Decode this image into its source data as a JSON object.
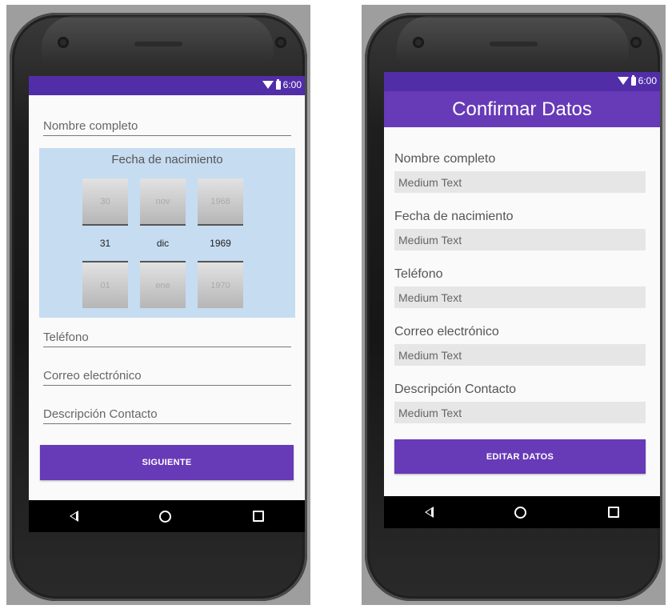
{
  "status": {
    "time": "6:00"
  },
  "form": {
    "name_placeholder": "Nombre completo",
    "date_title": "Fecha de nacimiento",
    "picker": {
      "day": {
        "prev": "30",
        "current": "31",
        "next": "01"
      },
      "month": {
        "prev": "nov",
        "current": "dic",
        "next": "ene"
      },
      "year": {
        "prev": "1968",
        "current": "1969",
        "next": "1970"
      }
    },
    "phone_placeholder": "Teléfono",
    "email_placeholder": "Correo electrónico",
    "description_placeholder": "Descripción Contacto",
    "next_button": "SIGUIENTE"
  },
  "confirm": {
    "title": "Confirmar Datos",
    "fields": [
      {
        "label": "Nombre completo",
        "value": "Medium Text"
      },
      {
        "label": "Fecha de nacimiento",
        "value": "Medium Text"
      },
      {
        "label": "Teléfono",
        "value": "Medium Text"
      },
      {
        "label": "Correo electrónico",
        "value": "Medium Text"
      },
      {
        "label": "Descripción Contacto",
        "value": "Medium Text"
      }
    ],
    "edit_button": "EDITAR DATOS"
  },
  "icons": [
    "wifi-icon",
    "battery-icon",
    "back-icon",
    "home-icon",
    "recents-icon"
  ],
  "colors": {
    "status_bar": "#512da8",
    "primary": "#673ab7",
    "picker_bg": "#c6dcf1"
  }
}
